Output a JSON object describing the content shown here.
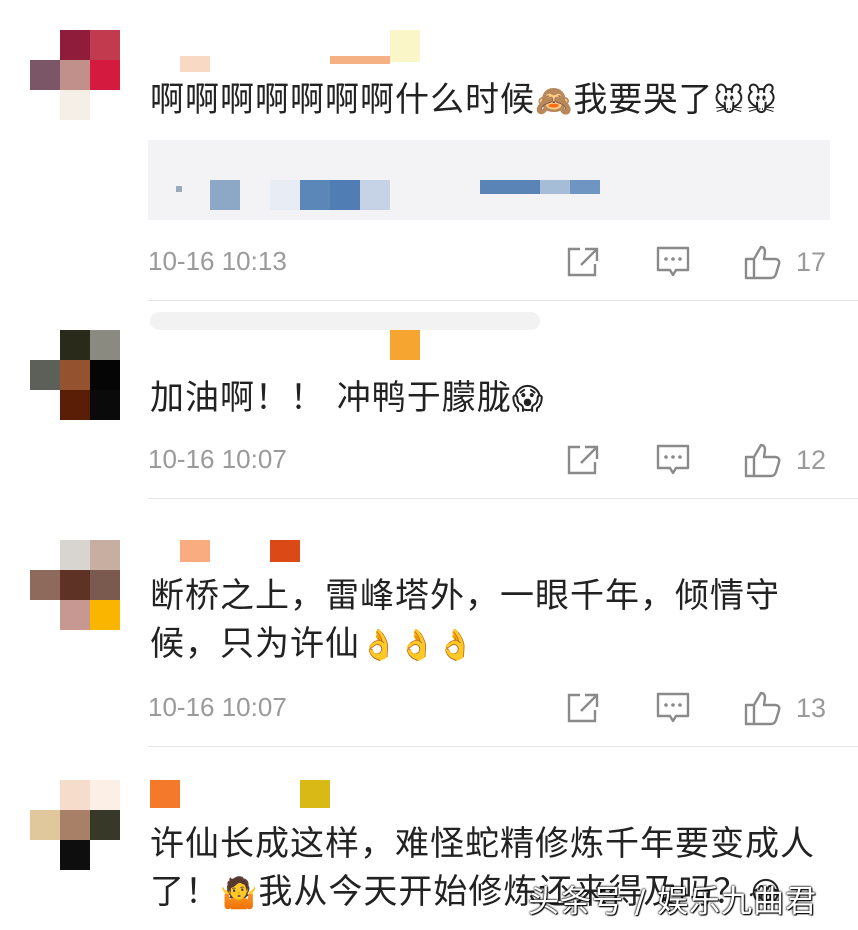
{
  "comments": [
    {
      "text": "啊啊啊啊啊啊啊什么时候",
      "text2": "我要哭了",
      "emoji1": "🙈",
      "emoji2": "🐭",
      "emoji3": "🐭",
      "time": "10-16 10:13",
      "likes": "17"
    },
    {
      "text": "加油啊！！ 冲鸭于朦胧",
      "emoji1": "😱",
      "time": "10-16 10:07",
      "likes": "12"
    },
    {
      "text": "断桥之上，雷峰塔外，一眼千年，倾情守",
      "text2": "候，只为许仙",
      "emoji1": "👌",
      "emoji2": "👌",
      "emoji3": "👌",
      "time": "10-16 10:07",
      "likes": "13"
    },
    {
      "text": "许仙长成这样，难怪蛇精修炼千年要变成人",
      "text2": "了！",
      "text3": "我从今天开始修炼还来得及吗？",
      "emoji1": "🤷",
      "emoji2": "😂"
    }
  ],
  "watermark": "头条号 / 娱乐九曲君",
  "icons": {
    "share": "share-icon",
    "reply": "comment-icon",
    "like": "thumbs-up-icon"
  }
}
